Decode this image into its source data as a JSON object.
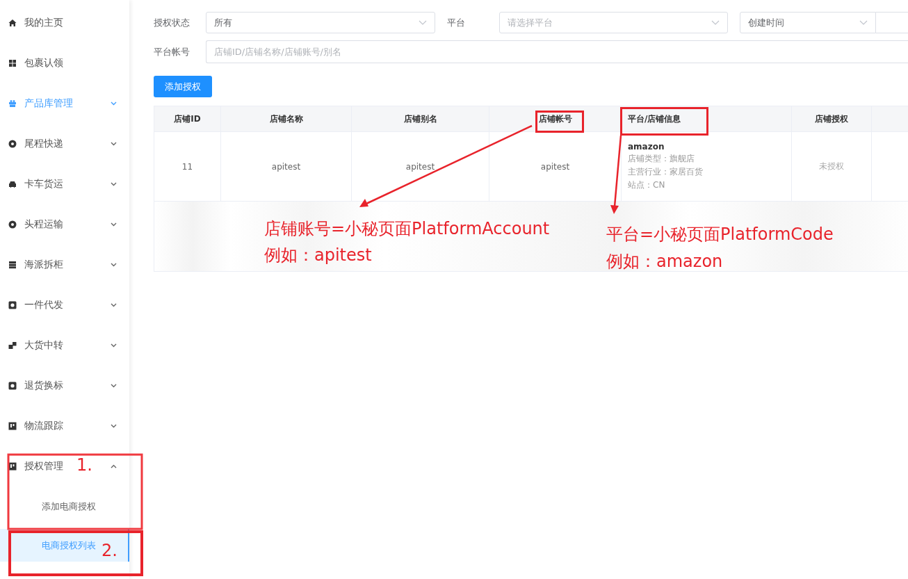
{
  "sidebar": {
    "items": [
      {
        "label": "我的主页",
        "kind": "link",
        "active": false
      },
      {
        "label": "包裹认领",
        "kind": "link",
        "active": false
      },
      {
        "label": "产品库管理",
        "kind": "group",
        "active": true,
        "expanded": false
      },
      {
        "label": "尾程快递",
        "kind": "group",
        "active": false,
        "expanded": false
      },
      {
        "label": "卡车货运",
        "kind": "group",
        "active": false,
        "expanded": false
      },
      {
        "label": "头程运输",
        "kind": "group",
        "active": false,
        "expanded": false
      },
      {
        "label": "海派拆柜",
        "kind": "group",
        "active": false,
        "expanded": false
      },
      {
        "label": "一件代发",
        "kind": "group",
        "active": false,
        "expanded": false
      },
      {
        "label": "大货中转",
        "kind": "group",
        "active": false,
        "expanded": false
      },
      {
        "label": "退货换标",
        "kind": "group",
        "active": false,
        "expanded": false
      },
      {
        "label": "物流跟踪",
        "kind": "group",
        "active": false,
        "expanded": false
      },
      {
        "label": "授权管理",
        "kind": "group",
        "active": false,
        "expanded": true,
        "children": [
          {
            "label": "添加电商授权",
            "selected": false
          },
          {
            "label": "电商授权列表",
            "selected": true
          }
        ]
      }
    ]
  },
  "filters": {
    "status": {
      "label": "授权状态",
      "value": "所有"
    },
    "platform": {
      "label": "平台",
      "placeholder": "请选择平台"
    },
    "time": {
      "value": "创建时间"
    },
    "account": {
      "label": "平台帐号",
      "placeholder": "店铺ID/店铺名称/店铺账号/别名"
    }
  },
  "add_button": "添加授权",
  "table": {
    "columns": [
      "店铺ID",
      "店铺名称",
      "店铺别名",
      "店铺帐号",
      "平台/店铺信息",
      "店铺授权"
    ],
    "rows": [
      {
        "id": "11",
        "name": "apitest",
        "alias": "apitest",
        "account": "apitest",
        "platform": "amazon",
        "info": [
          "店铺类型：旗舰店",
          "主营行业：家居百货",
          "站点：CN"
        ],
        "auth": "未授权"
      }
    ]
  },
  "annotations": {
    "callouts": [
      [
        "店铺账号=小秘页面PlatformAccount",
        "例如：apitest"
      ],
      [
        "平台=小秘页面PlatformCode",
        "例如：amazon"
      ]
    ],
    "steps": [
      "1.",
      "2."
    ]
  }
}
